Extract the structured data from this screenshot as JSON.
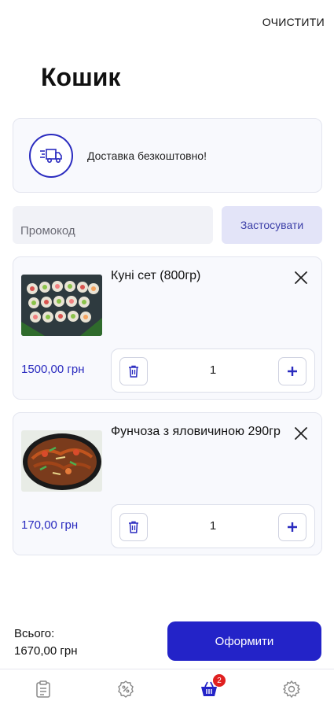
{
  "header": {
    "clear_label": "ОЧИСТИТИ",
    "title": "Кошик"
  },
  "delivery": {
    "icon": "delivery-truck-icon",
    "text": "Доставка безкоштовно!"
  },
  "promo": {
    "placeholder": "Промокод",
    "value": "",
    "apply_label": "Застосувати"
  },
  "items": [
    {
      "name": "Куні сет (800гр)",
      "price": "1500,00 грн",
      "quantity": "1",
      "image": "sushi-set-photo"
    },
    {
      "name": "Фунчоза з яловичиною 290гр",
      "price": "170,00 грн",
      "quantity": "1",
      "image": "funchoza-beef-photo"
    }
  ],
  "footer": {
    "total_label": "Всього:",
    "total_value": "1670,00 грн",
    "checkout_label": "Оформити"
  },
  "tabbar": {
    "tabs": [
      {
        "icon": "menu-list-icon"
      },
      {
        "icon": "percent-icon"
      },
      {
        "icon": "cart-icon",
        "badge": "2",
        "active": true
      },
      {
        "icon": "settings-icon"
      }
    ]
  },
  "colors": {
    "accent": "#2323c8",
    "price": "#2a2bbf",
    "badge": "#e02020"
  }
}
